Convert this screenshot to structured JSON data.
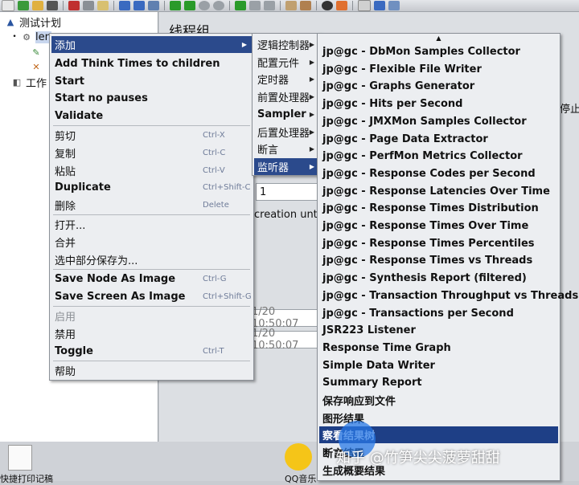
{
  "tree": {
    "root_label": "测试计划",
    "child_label": "len",
    "workbench_label": "工作"
  },
  "content": {
    "title": "线程组",
    "stop_label": "停止",
    "loop_value": "1",
    "creation_label": "creation unt",
    "time1": "1/20 10:50:07",
    "time2": "1/20 10:50:07"
  },
  "desktop": {
    "label_left": "快捷打印记稿",
    "label_qq": "QQ音乐"
  },
  "watermark": "知乎 @竹笋尖尖菠萝甜甜",
  "menu1": {
    "items": [
      {
        "label": "添加",
        "accel": "",
        "submenu": true
      },
      {
        "label": "Add Think Times to children",
        "accel": "",
        "bold": true
      },
      {
        "label": "Start",
        "accel": "",
        "bold": true
      },
      {
        "label": "Start no pauses",
        "accel": "",
        "bold": true
      },
      {
        "label": "Validate",
        "accel": "",
        "bold": true
      },
      {
        "label": "剪切",
        "accel": "Ctrl-X"
      },
      {
        "label": "复制",
        "accel": "Ctrl-C"
      },
      {
        "label": "粘贴",
        "accel": "Ctrl-V"
      },
      {
        "label": "Duplicate",
        "accel": "Ctrl+Shift-C",
        "bold": true
      },
      {
        "label": "删除",
        "accel": "Delete"
      },
      {
        "label": "打开...",
        "accel": ""
      },
      {
        "label": "合并",
        "accel": ""
      },
      {
        "label": "选中部分保存为...",
        "accel": ""
      },
      {
        "label": "Save Node As Image",
        "accel": "Ctrl-G",
        "bold": true
      },
      {
        "label": "Save Screen As Image",
        "accel": "Ctrl+Shift-G",
        "bold": true
      },
      {
        "label": "启用",
        "accel": "",
        "disabled": true
      },
      {
        "label": "禁用",
        "accel": ""
      },
      {
        "label": "Toggle",
        "accel": "Ctrl-T",
        "bold": true
      },
      {
        "label": "帮助",
        "accel": ""
      }
    ]
  },
  "menu2": {
    "items": [
      {
        "label": "逻辑控制器"
      },
      {
        "label": "配置元件"
      },
      {
        "label": "定时器"
      },
      {
        "label": "前置处理器"
      },
      {
        "label": "Sampler"
      },
      {
        "label": "后置处理器"
      },
      {
        "label": "断言"
      },
      {
        "label": "监听器"
      }
    ]
  },
  "menu3": {
    "scroll_up": "▲",
    "items": [
      "jp@gc - DbMon Samples Collector",
      "jp@gc - Flexible File Writer",
      "jp@gc - Graphs Generator",
      "jp@gc - Hits per Second",
      "jp@gc - JMXMon Samples Collector",
      "jp@gc - Page Data Extractor",
      "jp@gc - PerfMon Metrics Collector",
      "jp@gc - Response Codes per Second",
      "jp@gc - Response Latencies Over Time",
      "jp@gc - Response Times Distribution",
      "jp@gc - Response Times Over Time",
      "jp@gc - Response Times Percentiles",
      "jp@gc - Response Times vs Threads",
      "jp@gc - Synthesis Report (filtered)",
      "jp@gc - Transaction Throughput vs Threads",
      "jp@gc - Transactions per Second",
      "JSR223 Listener",
      "Response Time Graph",
      "Simple Data Writer",
      "Summary Report",
      "保存响应到文件",
      "图形结果",
      "察看结果树",
      "断言结果",
      "生成概要结果"
    ]
  }
}
